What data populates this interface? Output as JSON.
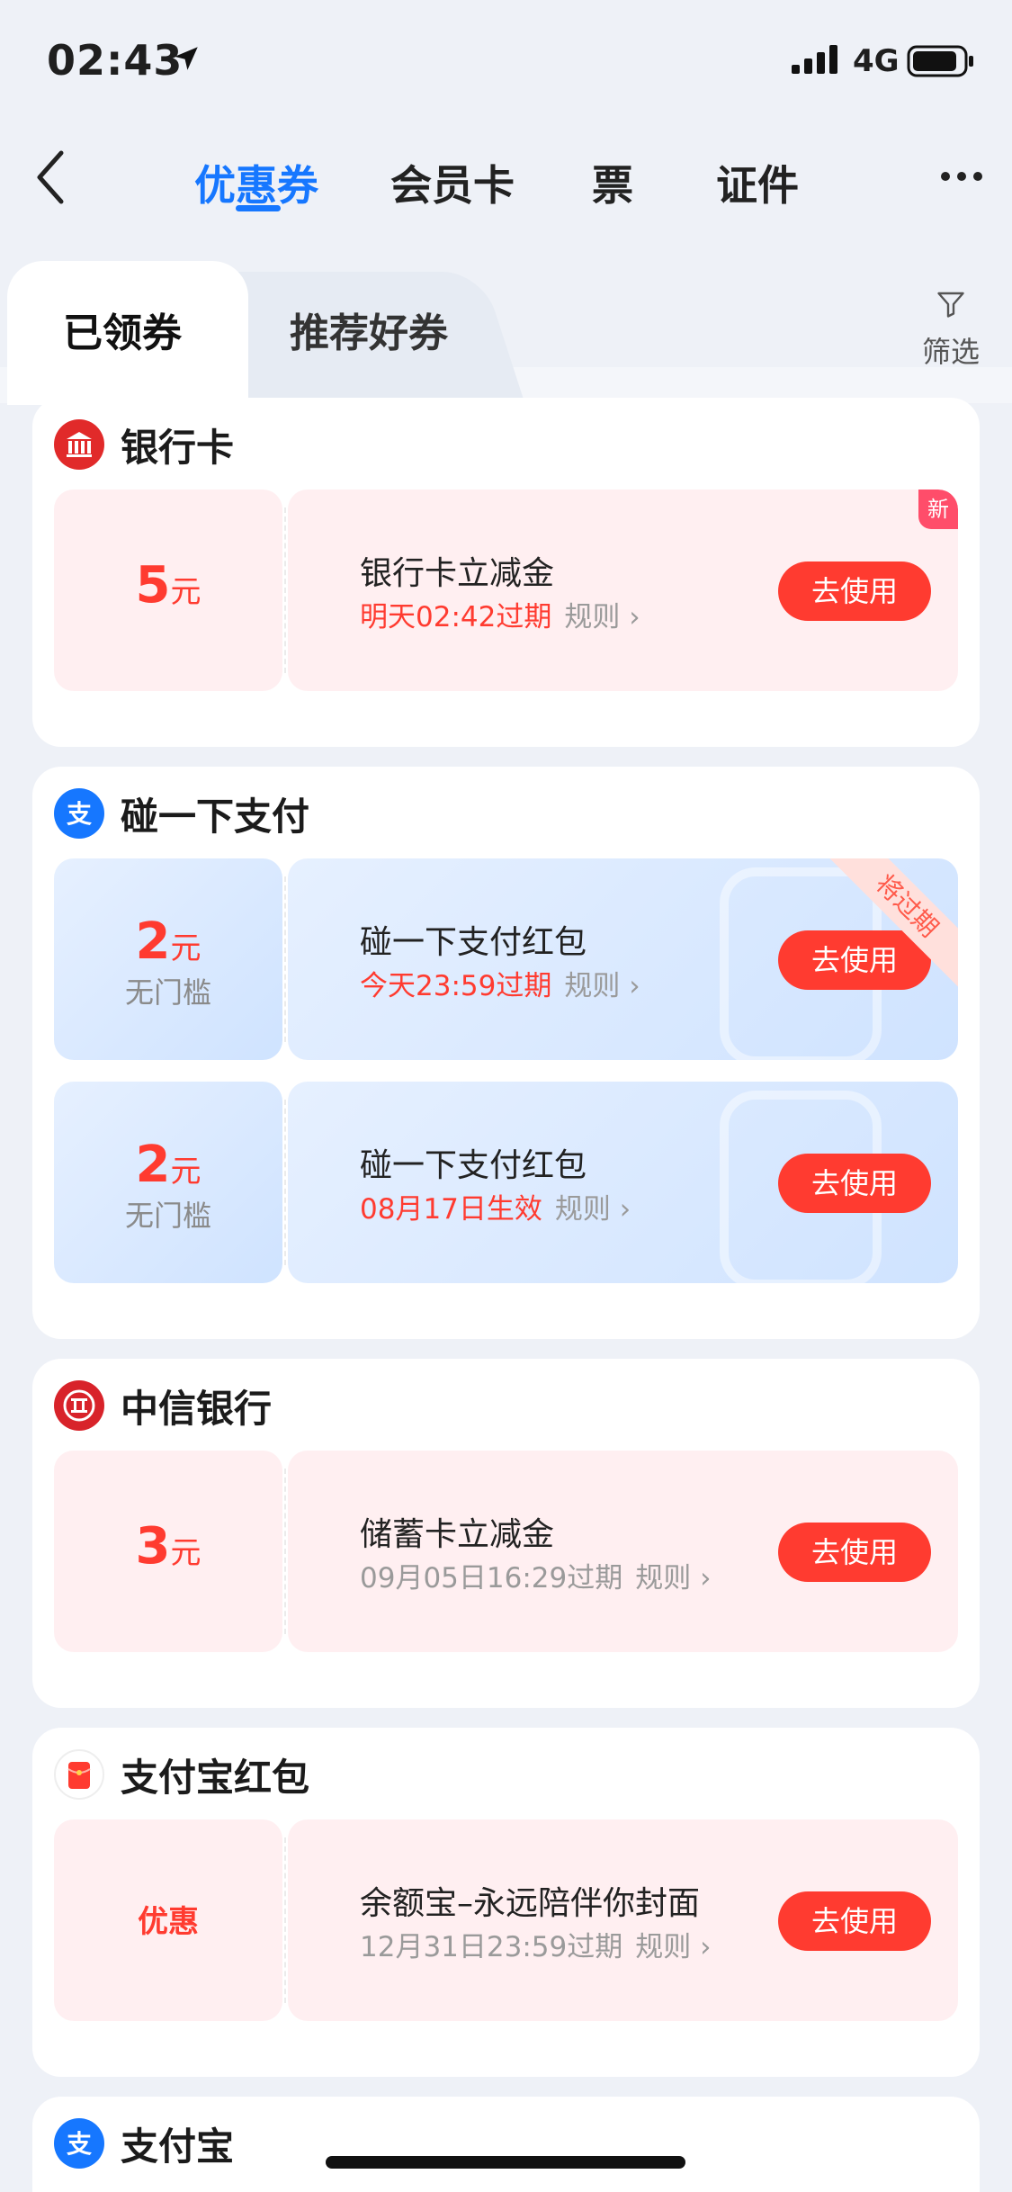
{
  "status_bar": {
    "time": "02:43",
    "network": "4G"
  },
  "nav": {
    "tabs": [
      {
        "label": "优惠券",
        "active": true
      },
      {
        "label": "会员卡",
        "active": false
      },
      {
        "label": "票",
        "active": false
      },
      {
        "label": "证件",
        "active": false
      }
    ]
  },
  "subtabs": {
    "active": "已领券",
    "inactive": "推荐好券",
    "filter": "筛选"
  },
  "colors": {
    "accent": "#1677ff",
    "red": "#ff3b30",
    "pink_bg": "#ffeff1"
  },
  "sections": [
    {
      "title": "银行卡",
      "icon": "bank-card-icon",
      "coupons": [
        {
          "amount": "5",
          "unit": "元",
          "title": "银行卡立减金",
          "expiry": "明天02:42过期",
          "rule": "规则",
          "button": "去使用",
          "badge": "新",
          "style": "pink"
        }
      ]
    },
    {
      "title": "碰一下支付",
      "icon": "alipay-icon",
      "coupons": [
        {
          "amount": "2",
          "unit": "元",
          "sub": "无门槛",
          "title": "碰一下支付红包",
          "expiry": "今天23:59过期",
          "rule": "规则",
          "button": "去使用",
          "ribbon": "将过期",
          "style": "blue"
        },
        {
          "amount": "2",
          "unit": "元",
          "sub": "无门槛",
          "title": "碰一下支付红包",
          "expiry": "08月17日生效",
          "rule": "规则",
          "button": "去使用",
          "style": "blue"
        }
      ]
    },
    {
      "title": "中信银行",
      "icon": "citic-bank-icon",
      "coupons": [
        {
          "amount": "3",
          "unit": "元",
          "title": "储蓄卡立减金",
          "expiry": "09月05日16:29过期",
          "rule": "规则",
          "button": "去使用",
          "style": "pink"
        }
      ]
    },
    {
      "title": "支付宝红包",
      "icon": "red-envelope-icon",
      "coupons": [
        {
          "amount": "优惠",
          "title": "余额宝–永远陪伴你封面",
          "expiry": "12月31日23:59过期",
          "rule": "规则",
          "button": "去使用",
          "style": "pink"
        }
      ]
    },
    {
      "title": "支付宝",
      "icon": "alipay-icon",
      "coupons": []
    }
  ]
}
